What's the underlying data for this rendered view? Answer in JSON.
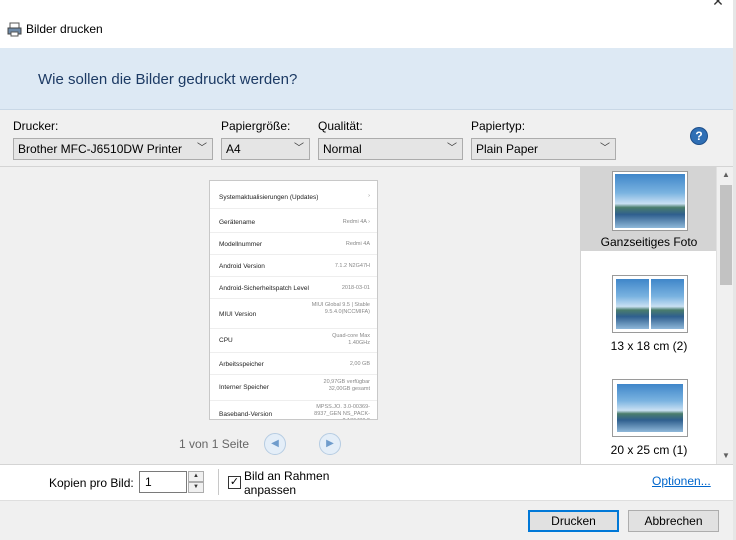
{
  "window": {
    "title": "Bilder drucken",
    "close_glyph": "✕"
  },
  "header": {
    "heading": "Wie sollen die Bilder gedruckt werden?"
  },
  "controls": {
    "printer": {
      "label": "Drucker:",
      "value": "Brother MFC-J6510DW Printer"
    },
    "paper_size": {
      "label": "Papiergröße:",
      "value": "A4"
    },
    "quality": {
      "label": "Qualität:",
      "value": "Normal"
    },
    "paper_type": {
      "label": "Papiertyp:",
      "value": "Plain Paper"
    },
    "help": "?"
  },
  "preview": {
    "rows": [
      {
        "key": "Systemaktualisierungen (Updates)",
        "value": "›"
      },
      {
        "key": "Gerätename",
        "value": "Redmi 4A  ›"
      },
      {
        "key": "Modellnummer",
        "value": "Redmi 4A"
      },
      {
        "key": "Android Version",
        "value": "7.1.2 N2G47H"
      },
      {
        "key": "Android-Sicherheitspatch Level",
        "value": "2018-03-01"
      },
      {
        "key": "MIUI Version",
        "value": "MIUI Global 9.5 | Stable 9.5.4.0(NCCMIFA)"
      },
      {
        "key": "CPU",
        "value": "Quad-core Max 1.40GHz"
      },
      {
        "key": "Arbeitsspeicher",
        "value": "2,00 GB"
      },
      {
        "key": "Interner Speicher",
        "value": "20,97GB verfügbar 32,00GB gesamt"
      },
      {
        "key": "Baseband-Version",
        "value": "MPSS.JO. 3.0-00369-8937_GEN NS_PACK-2.136430.2"
      }
    ],
    "pager": "1 von 1 Seite",
    "prev_glyph": "◀",
    "next_glyph": "▶"
  },
  "layouts": [
    {
      "label": "Ganzseitiges Foto",
      "selected": true
    },
    {
      "label": "13 x 18 cm (2)",
      "selected": false
    },
    {
      "label": "20 x 25 cm (1)",
      "selected": false
    }
  ],
  "copies": {
    "label": "Kopien pro Bild:",
    "value": "1",
    "fit_label": "Bild an Rahmen anpassen",
    "fit_checked": "✓",
    "options_link": "Optionen..."
  },
  "footer": {
    "print_button": "Drucken",
    "cancel_button": "Abbrechen"
  },
  "colors": {
    "header_bg": "#dde9f4",
    "heading": "#1c3a64",
    "link": "#0066cc",
    "primary_border": "#0078d7"
  },
  "icons": {
    "app": "printer-icon",
    "help": "help-icon"
  }
}
